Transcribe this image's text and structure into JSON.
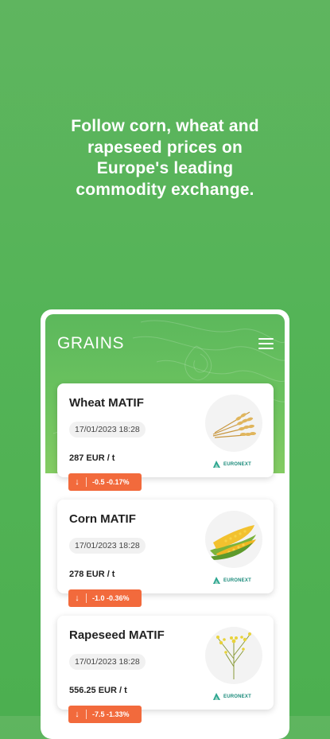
{
  "headline": {
    "line1": "Follow corn, wheat and",
    "line2": "rapeseed prices on",
    "line3": "Europe's leading",
    "line4": "commodity exchange."
  },
  "app": {
    "title": "GRAINS",
    "menu_icon": "hamburger-menu-icon"
  },
  "colors": {
    "background": "#54b457",
    "header": "#6cc35f",
    "change_negative": "#f26a3c"
  },
  "cards": [
    {
      "title": "Wheat MATIF",
      "date": "17/01/2023 18:28",
      "price": "287 EUR  / t",
      "change": "-0.5 -0.17%",
      "image": "wheat-icon",
      "source": "EURONEXT"
    },
    {
      "title": "Corn MATIF",
      "date": "17/01/2023 18:28",
      "price": "278 EUR  / t",
      "change": "-1.0 -0.36%",
      "image": "corn-icon",
      "source": "EURONEXT"
    },
    {
      "title": "Rapeseed MATIF",
      "date": "17/01/2023 18:28",
      "price": "556.25 EUR  / t",
      "change": "-7.5 -1.33%",
      "image": "rapeseed-icon",
      "source": "EURONEXT"
    }
  ]
}
